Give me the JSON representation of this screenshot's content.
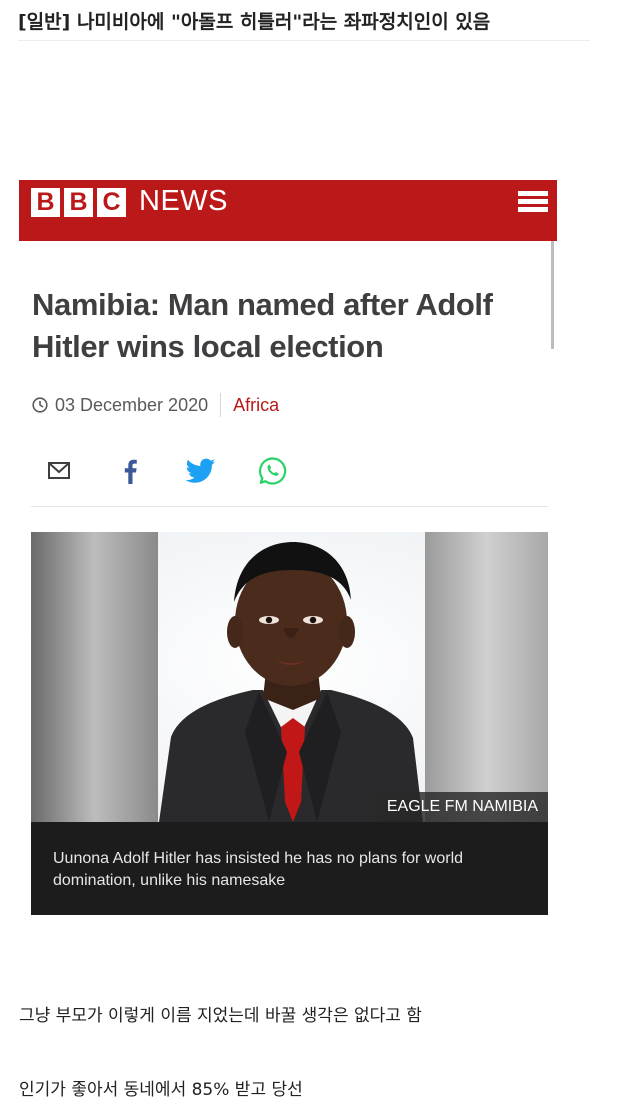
{
  "post": {
    "title": "[일반] 나미비아에 \"아돌프 히틀러\"라는 좌파정치인이 있음",
    "lines": [
      "그냥 부모가 이렇게 이름 지었는데 바꿀 생각은 없다고 함",
      "인기가 좋아서 동네에서 85% 받고 당선"
    ]
  },
  "bbc": {
    "logo_letters": [
      "B",
      "B",
      "C"
    ],
    "logo_news": "NEWS",
    "headline": "Namibia: Man named after Adolf Hitler wins local election",
    "date": "03 December 2020",
    "category": "Africa",
    "share_icons": [
      "email-icon",
      "facebook-icon",
      "twitter-icon",
      "whatsapp-icon"
    ],
    "photo_credit": "EAGLE FM NAMIBIA",
    "caption": "Uunona Adolf Hitler has insisted he has no plans for world domination, unlike his namesake"
  },
  "colors": {
    "bbc_red": "#bb1919",
    "facebook": "#3b5998",
    "twitter": "#1da1f2",
    "whatsapp": "#25d366"
  }
}
